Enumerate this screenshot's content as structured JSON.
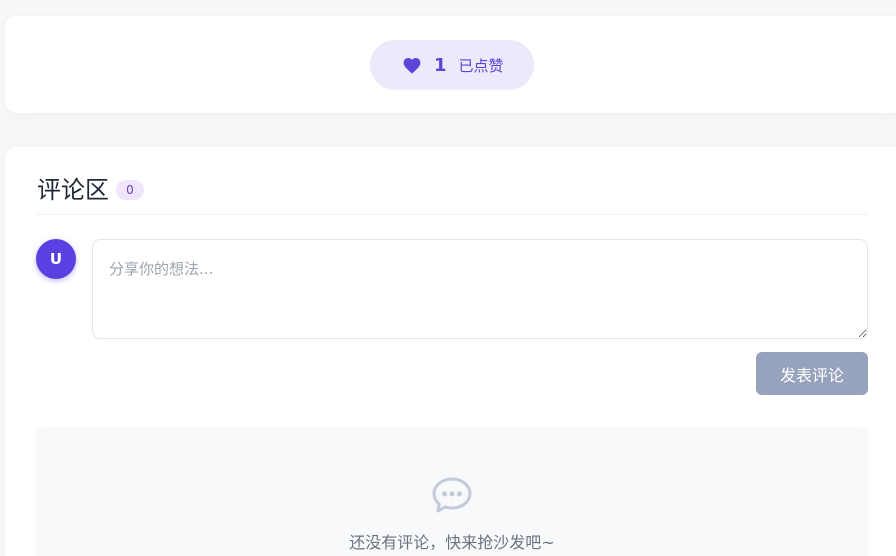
{
  "like": {
    "count": "1",
    "status_label": "已点赞",
    "icon": "heart-icon",
    "accent_color": "#5b44d8"
  },
  "comments": {
    "title": "评论区",
    "count": "0",
    "avatar_initial": "U",
    "input_placeholder": "分享你的想法...",
    "input_value": "",
    "submit_label": "发表评论",
    "empty_icon": "chat-bubble-icon",
    "empty_text": "还没有评论，快来抢沙发吧~"
  }
}
